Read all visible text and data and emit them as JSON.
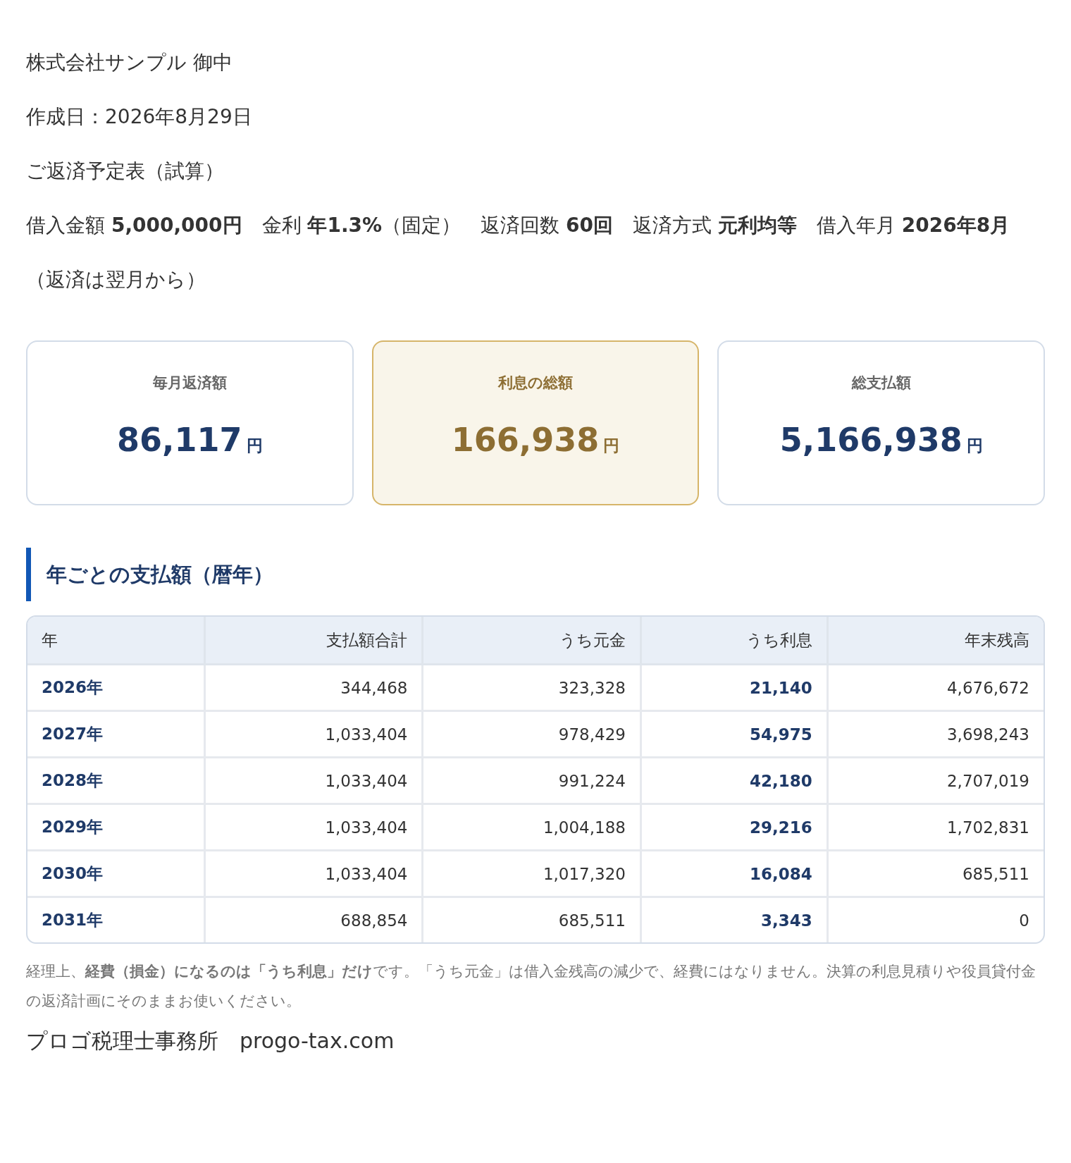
{
  "header": {
    "recipient": "株式会社サンプル 御中",
    "created": "作成日：2026年8月29日",
    "title": "ご返済予定表（試算）",
    "params": "借入金額 **5,000,000円**　金利 **年1.3%**（固定）　返済回数 **60回**　返済方式 **元利均等**　借入年月 **2026年8月**（返済は翌月から）"
  },
  "cards": [
    {
      "label": "毎月返済額",
      "value": "86,117",
      "unit": "円",
      "highlighted": false
    },
    {
      "label": "利息の総額",
      "value": "166,938",
      "unit": "円",
      "highlighted": true
    },
    {
      "label": "総支払額",
      "value": "5,166,938",
      "unit": "円",
      "highlighted": false
    }
  ],
  "section_title": "年ごとの支払額（暦年）",
  "table": {
    "columns": [
      "年",
      "支払額合計",
      "うち元金",
      "うち利息",
      "年末残高"
    ],
    "rows": [
      [
        "2026年",
        "344,468",
        "323,328",
        "21,140",
        "4,676,672"
      ],
      [
        "2027年",
        "1,033,404",
        "978,429",
        "54,975",
        "3,698,243"
      ],
      [
        "2028年",
        "1,033,404",
        "991,224",
        "42,180",
        "2,707,019"
      ],
      [
        "2029年",
        "1,033,404",
        "1,004,188",
        "29,216",
        "1,702,831"
      ],
      [
        "2030年",
        "1,033,404",
        "1,017,320",
        "16,084",
        "685,511"
      ],
      [
        "2031年",
        "688,854",
        "685,511",
        "3,343",
        "0"
      ]
    ]
  },
  "note": "経理上、**経費（損金）になるのは「うち利息」だけ**です。「うち元金」は借入金残高の減少で、経費にはなりません。決算の利息見積りや役員貸付金の返済計画にそのままお使いください。",
  "footer": "プロゴ税理士事務所　progo-tax.com"
}
